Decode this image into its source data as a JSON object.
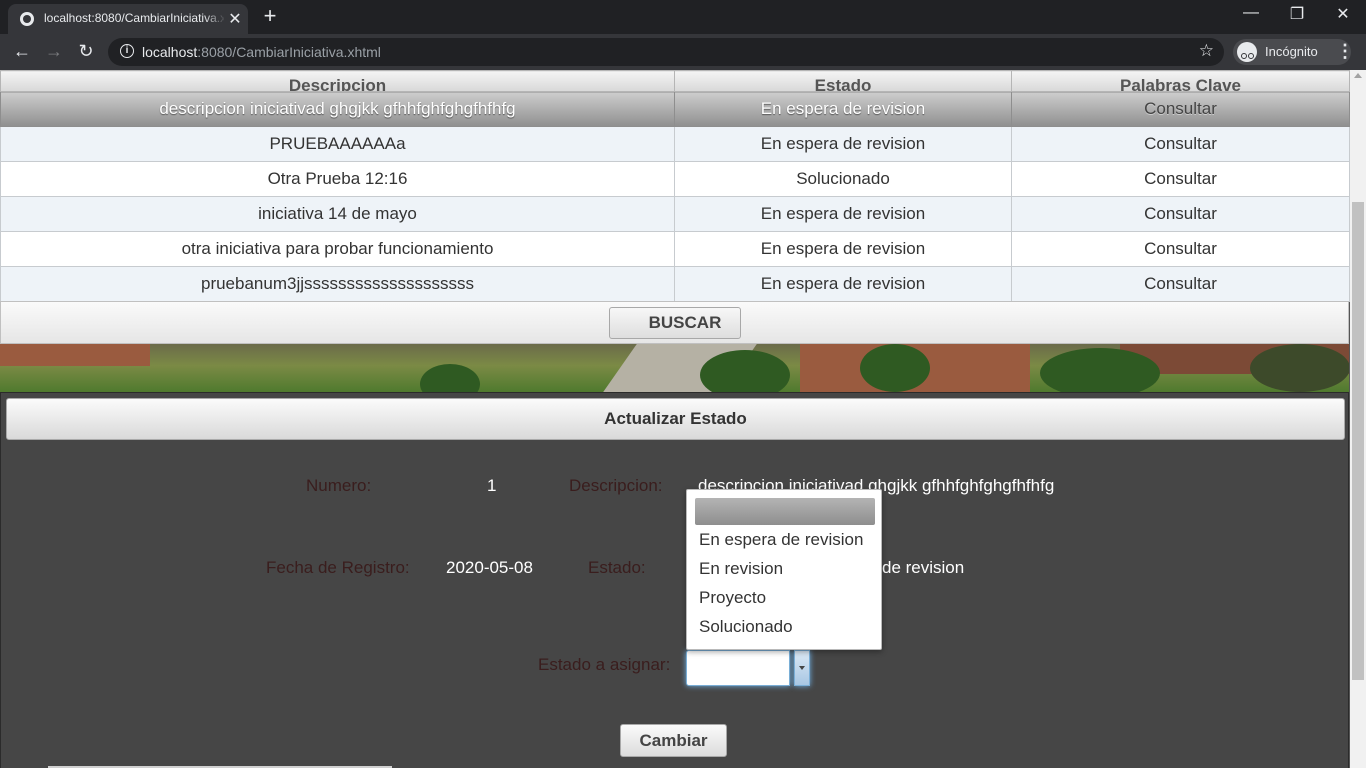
{
  "browser": {
    "tab_title": "localhost:8080/CambiarIniciativa.xhtml",
    "new_tab": "+",
    "tab_close": "✕",
    "url_host": "localhost",
    "url_rest": ":8080/CambiarIniciativa.xhtml",
    "incognito_label": "Incógnito",
    "back": "←",
    "forward": "→",
    "reload": "↻",
    "minimize": "—",
    "restore": "❐",
    "close": "✕",
    "star": "☆",
    "info": "i",
    "menu": "⋮"
  },
  "table": {
    "headers": [
      "Descripcion",
      "Estado",
      "Palabras Clave"
    ],
    "rows": [
      {
        "descripcion": "descripcion iniciativad ghgjkk gfhhfghfghgfhfhfg",
        "estado": "En espera de revision",
        "palabras": "Consultar"
      },
      {
        "descripcion": "PRUEBAAAAAAa",
        "estado": "En espera de revision",
        "palabras": "Consultar"
      },
      {
        "descripcion": "Otra Prueba 12:16",
        "estado": "Solucionado",
        "palabras": "Consultar"
      },
      {
        "descripcion": "iniciativa 14 de mayo",
        "estado": "En espera de revision",
        "palabras": "Consultar"
      },
      {
        "descripcion": "otra iniciativa para probar funcionamiento",
        "estado": "En espera de revision",
        "palabras": "Consultar"
      },
      {
        "descripcion": "pruebanum3jjssssssssssssssssssss",
        "estado": "En espera de revision",
        "palabras": "Consultar"
      }
    ],
    "buscar_label": "BUSCAR"
  },
  "panel": {
    "title": "Actualizar Estado",
    "numero_label": "Numero:",
    "numero_value": "1",
    "descripcion_label": "Descripcion:",
    "descripcion_value": "descripcion iniciativad ghgjkk gfhhfghfghgfhfhfg",
    "fecha_label": "Fecha de Registro:",
    "fecha_value": "2020-05-08",
    "estado_label": "Estado:",
    "estado_value_visible": "de revision",
    "asignar_label": "Estado a asignar:",
    "asignar_value": "",
    "cambiar_label": "Cambiar"
  },
  "dropdown": {
    "options": [
      "",
      "En espera de revision",
      "En revision",
      "Proyecto",
      "Solucionado"
    ]
  },
  "colors": {
    "chrome_dark": "#202124",
    "chrome_toolbar": "#35363a",
    "panel_bg": "#464646",
    "label_text": "#3a1d1d",
    "focus_glow": "#6fb0e6"
  }
}
